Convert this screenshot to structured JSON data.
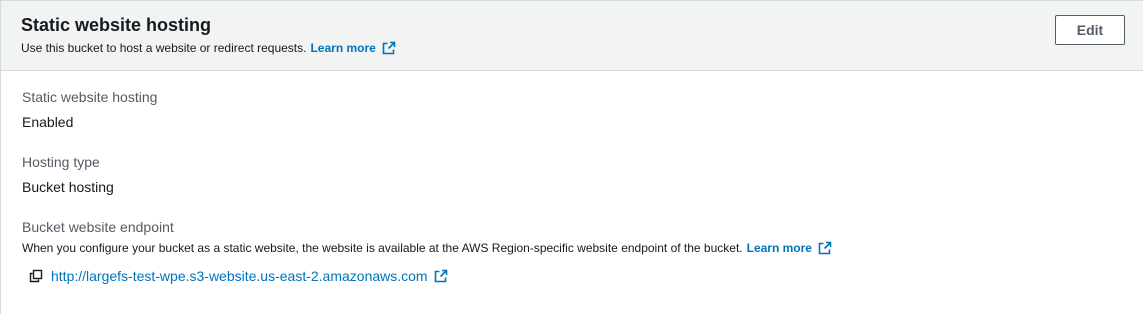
{
  "header": {
    "title": "Static website hosting",
    "description": "Use this bucket to host a website or redirect requests.",
    "learn_more": "Learn more",
    "edit_label": "Edit"
  },
  "fields": {
    "hosting": {
      "label": "Static website hosting",
      "value": "Enabled"
    },
    "hosting_type": {
      "label": "Hosting type",
      "value": "Bucket hosting"
    },
    "endpoint": {
      "label": "Bucket website endpoint",
      "description": "When you configure your bucket as a static website, the website is available at the AWS Region-specific website endpoint of the bucket.",
      "learn_more": "Learn more",
      "url": "http://largefs-test-wpe.s3-website.us-east-2.amazonaws.com"
    }
  },
  "icons": {
    "external": "external-link-icon",
    "copy": "copy-icon"
  },
  "colors": {
    "link": "#0073bb",
    "header_bg": "#f2f3f3",
    "border": "#d5dbdb"
  }
}
